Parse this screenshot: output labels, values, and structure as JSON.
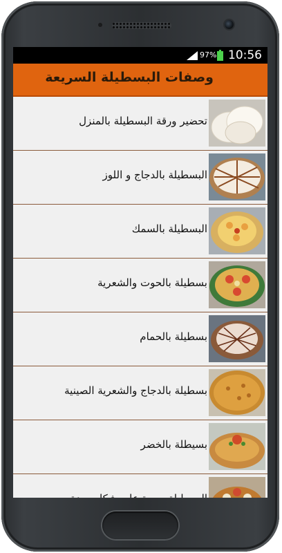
{
  "status_bar": {
    "battery_percent": "97%",
    "time": "10:56",
    "battery_color": "#4cd24c"
  },
  "app": {
    "title": "وصفات البسطيلة السريعة",
    "accent_color": "#e0640f"
  },
  "recipes": [
    {
      "label": "تحضير ورقة البسطيلة بالمنزل",
      "thumbnail_icon": "pastry-sheets-photo"
    },
    {
      "label": "البسطيلة بالدجاج و اللوز",
      "thumbnail_icon": "chicken-almond-pastilla-photo"
    },
    {
      "label": "البسطيلة بالسمك",
      "thumbnail_icon": "fish-pastilla-photo"
    },
    {
      "label": "بسطيلة بالحوت والشعرية",
      "thumbnail_icon": "fish-vermicelli-pastilla-photo"
    },
    {
      "label": "بسطيلة بالحمام",
      "thumbnail_icon": "pigeon-pastilla-photo"
    },
    {
      "label": "بسطيلة بالدجاج والشعرية الصينية",
      "thumbnail_icon": "chicken-noodle-pastilla-photo"
    },
    {
      "label": "بسيطلة بالخضر",
      "thumbnail_icon": "vegetable-pastilla-photo"
    },
    {
      "label": "البسطيلة محوة على شكل مودة",
      "thumbnail_icon": "pastilla-partial-photo"
    }
  ]
}
